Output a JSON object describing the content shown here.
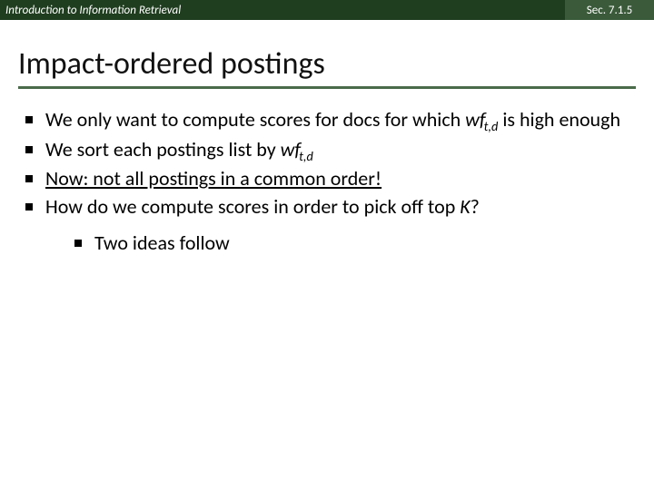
{
  "header": {
    "left": "Introduction to Information Retrieval",
    "right": "Sec. 7.1.5"
  },
  "title": "Impact-ordered postings",
  "bullets": {
    "b1_a": "We only want to compute scores for docs for which ",
    "b1_wf": "wf",
    "b1_sub": "t,d",
    "b1_b": " is high enough",
    "b2_a": "We sort each postings list by ",
    "b2_wf": "wf",
    "b2_sub": "t,d",
    "b3": "Now: not all postings in a common order!",
    "b4_a": "How do we compute scores in order to pick off top ",
    "b4_k": "K",
    "b4_b": "?",
    "sub1": "Two ideas follow"
  }
}
